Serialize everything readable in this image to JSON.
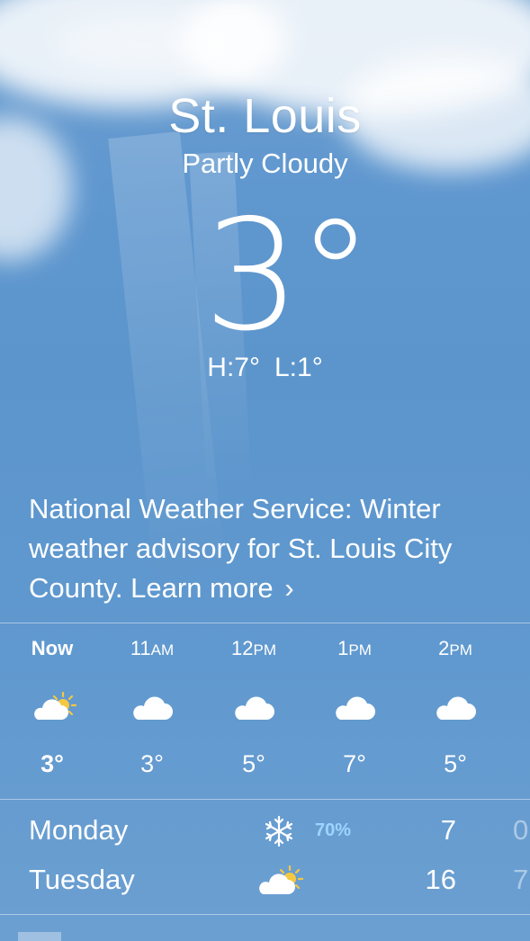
{
  "location": {
    "city": "St. Louis",
    "condition": "Partly Cloudy",
    "temperature": "3°",
    "high": "H:7°",
    "low": "L:1°"
  },
  "alert": {
    "text": "National Weather Service: Winter weather advisory for St. Louis City County. Learn more",
    "chevron": "›"
  },
  "hourly": [
    {
      "time": "Now",
      "suffix": "",
      "icon": "partly-cloudy-icon",
      "temp": "3°"
    },
    {
      "time": "11",
      "suffix": "AM",
      "icon": "cloud-icon",
      "temp": "3°"
    },
    {
      "time": "12",
      "suffix": "PM",
      "icon": "cloud-icon",
      "temp": "5°"
    },
    {
      "time": "1",
      "suffix": "PM",
      "icon": "cloud-icon",
      "temp": "7°"
    },
    {
      "time": "2",
      "suffix": "PM",
      "icon": "cloud-icon",
      "temp": "5°"
    }
  ],
  "daily": [
    {
      "day": "Monday",
      "icon": "snowflake-icon",
      "precip": "70%",
      "high": "7",
      "low": "0"
    },
    {
      "day": "Tuesday",
      "icon": "partly-cloudy-icon",
      "precip": "",
      "high": "16",
      "low": "7"
    }
  ],
  "colors": {
    "sky": "#5f97cf",
    "precip_text": "#9fd3ff",
    "sun": "#f5c842"
  }
}
